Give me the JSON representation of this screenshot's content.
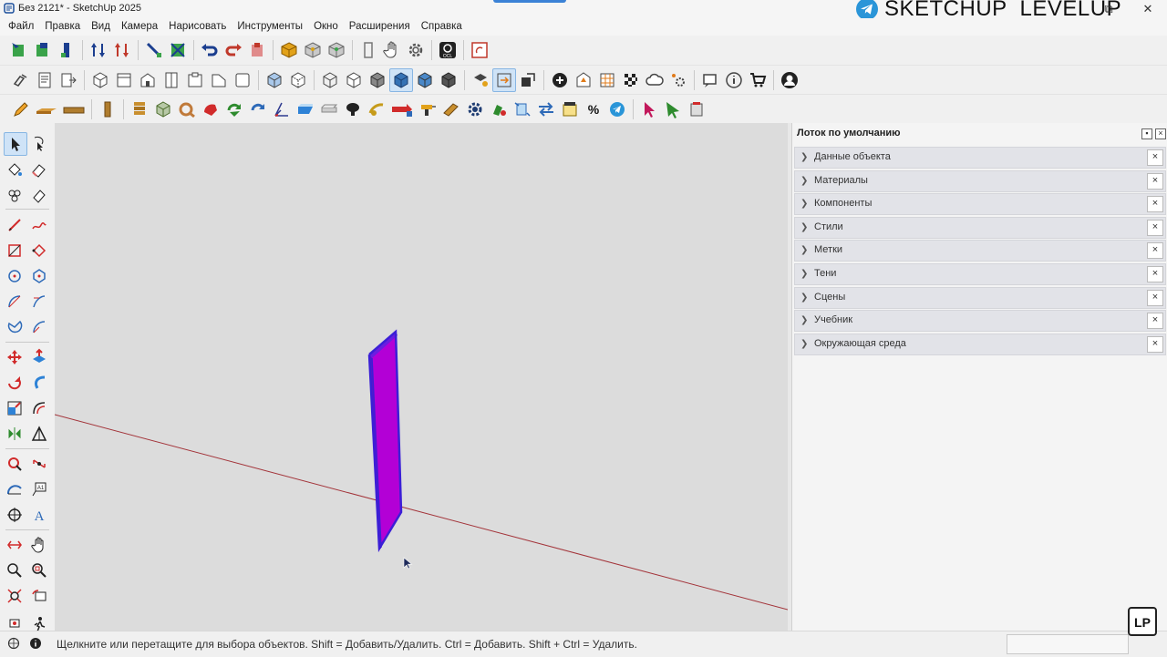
{
  "window": {
    "title": "Без 2121* - SketchUp 2025",
    "brand": "SKETCHUP_LEVELUP"
  },
  "menu": [
    "Файл",
    "Правка",
    "Вид",
    "Камера",
    "Нарисовать",
    "Инструменты",
    "Окно",
    "Расширения",
    "Справка"
  ],
  "tray": {
    "title": "Лоток по умолчанию",
    "panels": [
      {
        "label": "Данные объекта"
      },
      {
        "label": "Материалы"
      },
      {
        "label": "Компоненты"
      },
      {
        "label": "Стили"
      },
      {
        "label": "Метки"
      },
      {
        "label": "Тени"
      },
      {
        "label": "Сцены"
      },
      {
        "label": "Учебник"
      },
      {
        "label": "Окружающая среда"
      }
    ]
  },
  "statusbar": {
    "hint": "Щелкните или перетащите для выбора объектов. Shift = Добавить/Удалить. Ctrl = Добавить. Shift + Ctrl = Удалить."
  },
  "badge": "LP",
  "colors": {
    "accent": "#3b82d6",
    "object_face": "#b300d6",
    "object_edge": "#3b1fd6",
    "red_axis": "#a3343a",
    "viewport_bg": "#dcdcdc"
  }
}
